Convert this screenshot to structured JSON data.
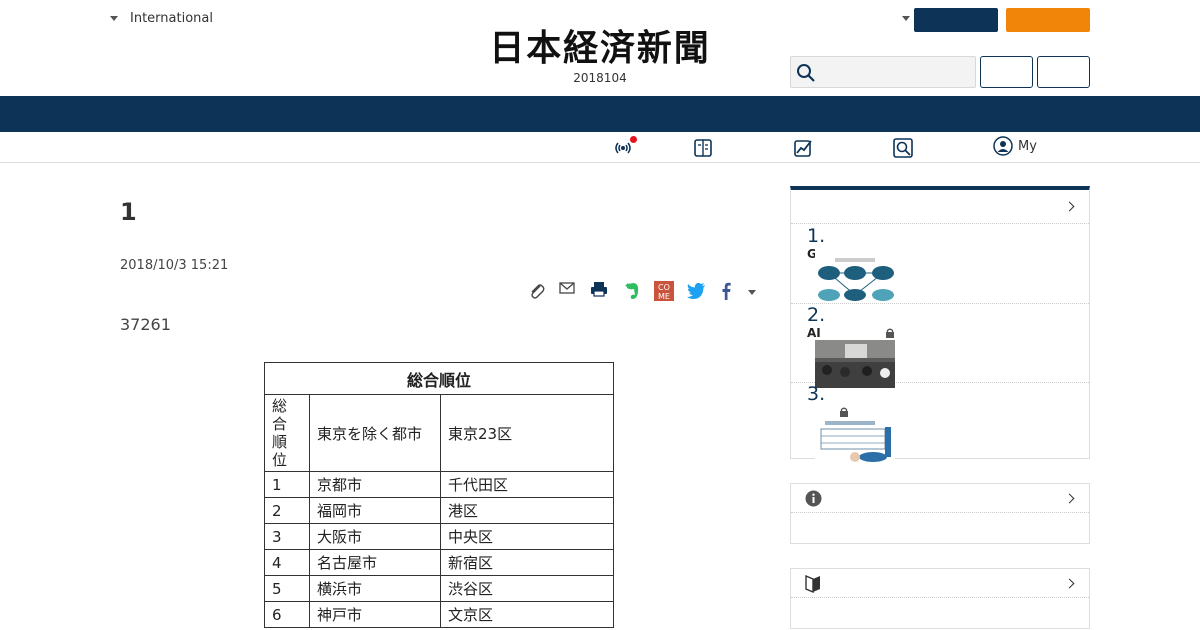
{
  "header": {
    "region_label": "International",
    "logo_text": "日本経済新聞",
    "date_line": "2018104",
    "brand_navy": "#0d3356",
    "accent_orange": "#f0850a"
  },
  "subnav": {
    "icons": [
      "broadcast-icon",
      "paper-edition-icon",
      "chart-icon",
      "search-lens-icon",
      "user-icon"
    ],
    "my_label": "My"
  },
  "article": {
    "title": "1",
    "date": "2018/10/3 15:21",
    "lead": "37261",
    "share_icons": [
      "clip-icon",
      "mail-icon",
      "print-icon",
      "evernote-icon",
      "come-icon",
      "twitter-icon",
      "facebook-icon",
      "more-caret-icon"
    ],
    "table": {
      "title": "総合順位",
      "col1_header": "総合順位",
      "col2_header": "東京を除く都市",
      "col3_header": "東京23区",
      "rows": [
        [
          "1",
          "京都市",
          "千代田区"
        ],
        [
          "2",
          "福岡市",
          "港区"
        ],
        [
          "3",
          "大阪市",
          "中央区"
        ],
        [
          "4",
          "名古屋市",
          "新宿区"
        ],
        [
          "5",
          "横浜市",
          "渋谷区"
        ],
        [
          "6",
          "神戸市",
          "文京区"
        ]
      ]
    }
  },
  "sidebar": {
    "ranking": [
      {
        "num": "1.",
        "label": "GM",
        "thumb": "diagram"
      },
      {
        "num": "2.",
        "label": "AI",
        "thumb": "photo"
      },
      {
        "num": "3.",
        "label": "",
        "thumb": "chart"
      }
    ]
  }
}
